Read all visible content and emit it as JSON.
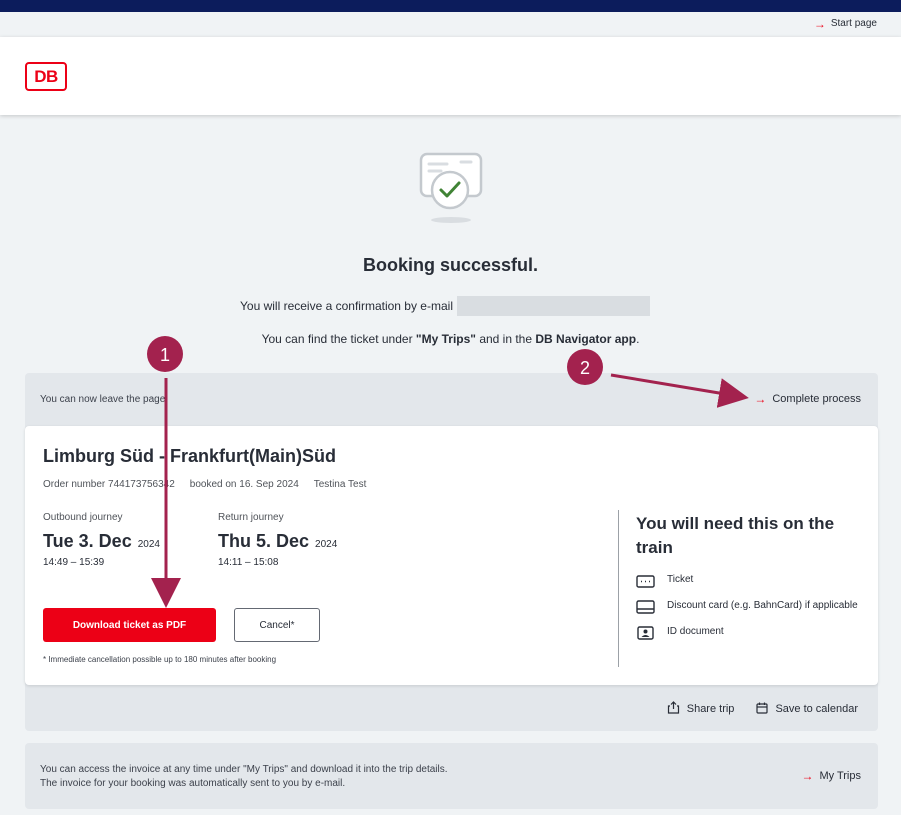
{
  "utility": {
    "start_page": "Start page"
  },
  "header": {
    "logo": "DB"
  },
  "hero": {
    "icon": "ticket-check-icon"
  },
  "status": {
    "title": "Booking successful.",
    "confirm_text": "You will receive a confirmation by e-mail",
    "hint_prefix": "You can find the ticket under ",
    "hint_mytrips": "\"My Trips\"",
    "hint_middle": " and in the ",
    "hint_app": "DB Navigator app",
    "hint_suffix": "."
  },
  "panel": {
    "leave_text": "You can now leave the page.",
    "complete_label": "Complete process"
  },
  "booking": {
    "route": "Limburg Süd  -  Frankfurt(Main)Süd",
    "order_number": "Order number 744173756342",
    "booked_on": "booked on 16. Sep 2024",
    "passenger": "Testina Test",
    "outbound": {
      "label": "Outbound journey",
      "day": "Tue 3. Dec",
      "year": "2024",
      "time": "14:49 – 15:39"
    },
    "return": {
      "label": "Return journey",
      "day": "Thu 5. Dec",
      "year": "2024",
      "time": "14:11 – 15:08"
    },
    "download_label": "Download ticket as PDF",
    "cancel_label": "Cancel*",
    "footnote": "* Immediate cancellation possible up to 180 minutes after booking"
  },
  "need": {
    "title": "You will need this on the train",
    "items": [
      {
        "label": "Ticket",
        "icon": "ticket-icon"
      },
      {
        "label": "Discount card (e.g. BahnCard) if applicable",
        "icon": "card-icon"
      },
      {
        "label": "ID document",
        "icon": "id-card-icon"
      }
    ]
  },
  "actions": {
    "share": "Share trip",
    "calendar": "Save to calendar"
  },
  "invoice": {
    "line1": "You can access the invoice at any time under \"My Trips\" and download it into the trip details.",
    "line2": "The invoice for your booking was automatically sent to you by e-mail.",
    "link": "My Trips"
  },
  "annotations": {
    "badge1": "1",
    "badge2": "2"
  },
  "colors": {
    "accent": "#ec0016",
    "navy": "#0c1c5c",
    "annotation": "#a3224e"
  }
}
